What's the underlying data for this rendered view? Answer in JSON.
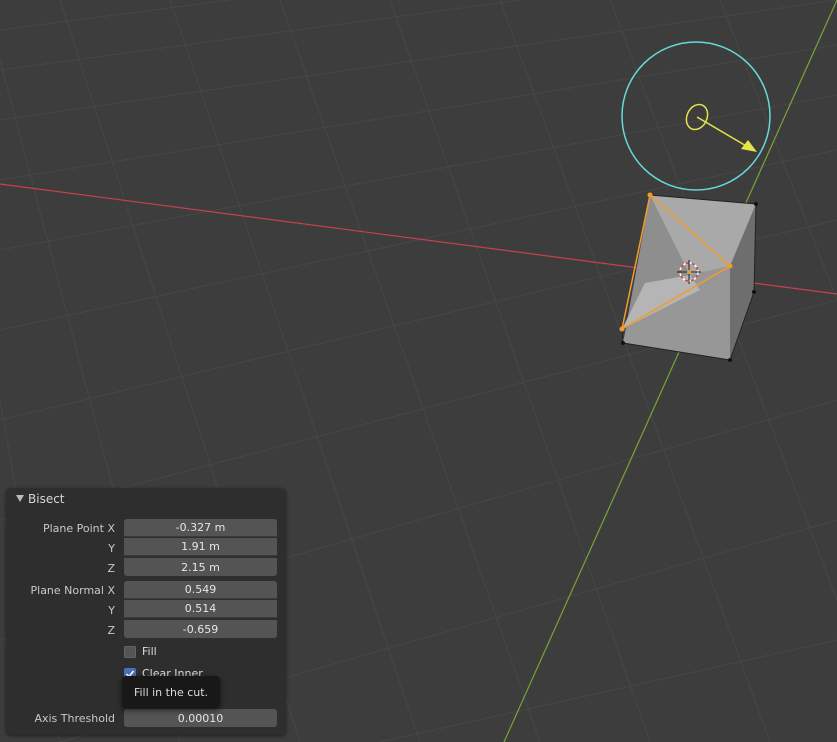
{
  "panel": {
    "title": "Bisect",
    "plane_point": {
      "label": "Plane Point X",
      "y_label": "Y",
      "z_label": "Z",
      "x": "-0.327 m",
      "y": "1.91 m",
      "z": "2.15 m"
    },
    "plane_normal": {
      "label": "Plane Normal X",
      "y_label": "Y",
      "z_label": "Z",
      "x": "0.549",
      "y": "0.514",
      "z": "-0.659"
    },
    "fill": {
      "label": "Fill",
      "checked": false
    },
    "clear_inner": {
      "label": "Clear Inner",
      "checked": true
    },
    "axis_threshold": {
      "label": "Axis Threshold",
      "value": "0.00010"
    }
  },
  "tooltip": {
    "text": "Fill in the cut."
  },
  "colors": {
    "background": "#3d3d3d",
    "x_axis": "#c9404f",
    "y_axis": "#7aa336",
    "selection": "#f39c2b",
    "gizmo_circle": "#66d9d9",
    "gizmo_arrow": "#e6e34a",
    "panel": "#2e2e2e",
    "field": "#545454"
  }
}
